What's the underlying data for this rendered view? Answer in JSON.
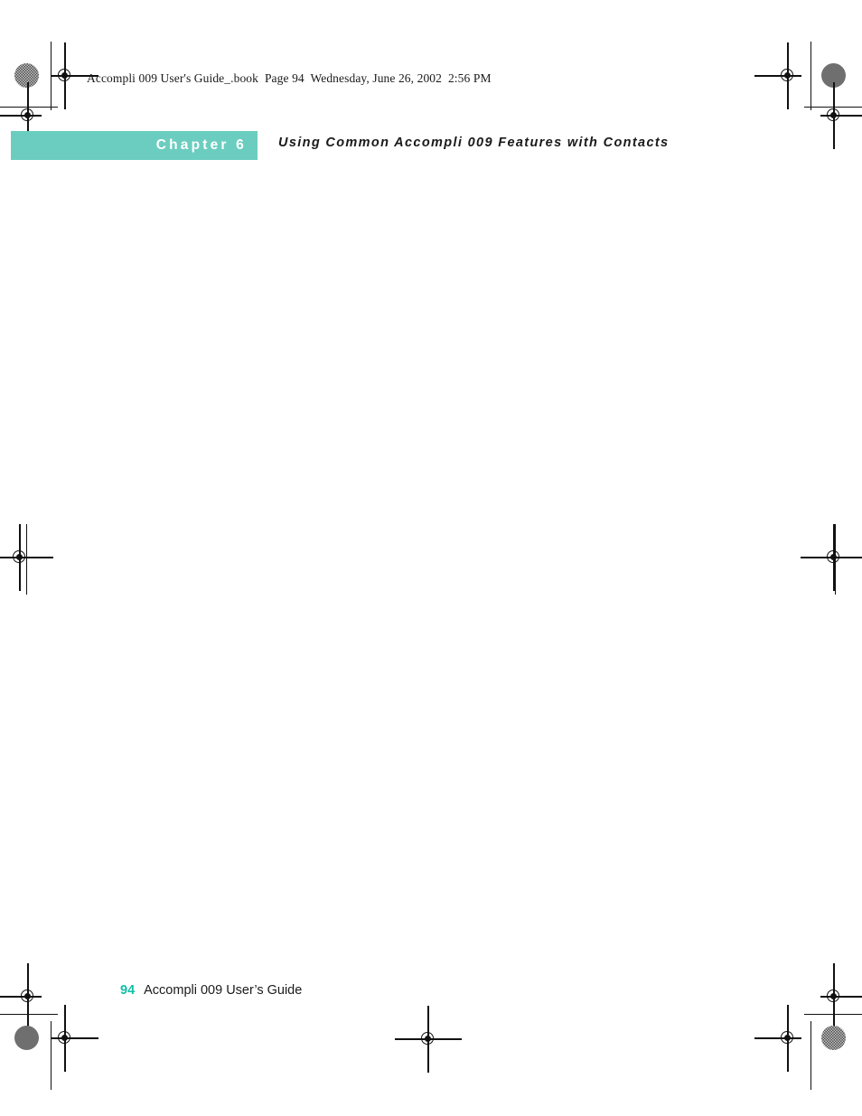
{
  "document": {
    "book_header": "Accompli 009 User's Guide_.book  Page 94  Wednesday, June 26, 2002  2:56 PM",
    "page_number": "94"
  },
  "running_head": {
    "chapter_label": "Chapter 6",
    "title": "Using Common Accompli 009 Features with Contacts",
    "bar_color": "#6bcdbf",
    "label_color": "#ffffff"
  },
  "body": {
    "content": ""
  },
  "footer": {
    "folio": "94",
    "title": "Accompli 009 User’s Guide",
    "folio_color": "#13bfa6"
  },
  "print_marks": {
    "registration_target": "registration-target-icon",
    "halftone_dot": "halftone-density-dot-icon",
    "trim_line": "trim-crop-line"
  }
}
